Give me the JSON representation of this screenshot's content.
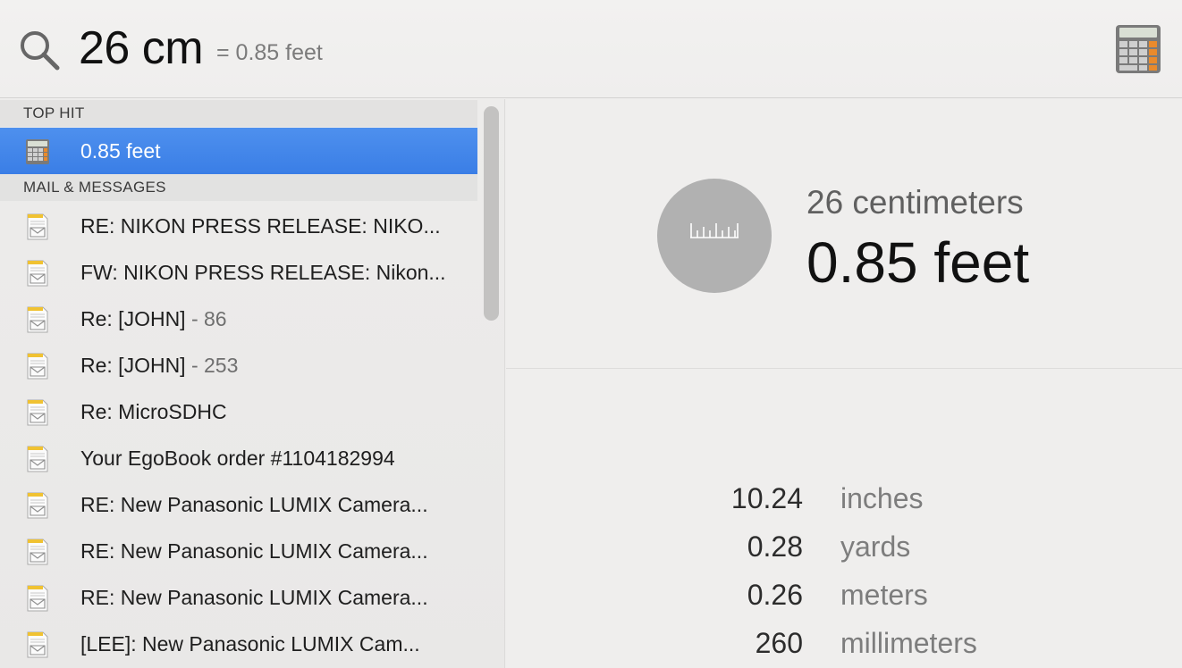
{
  "search": {
    "query": "26 cm",
    "inline_result": "= 0.85 feet",
    "search_icon": "magnifier-icon",
    "app_icon": "calculator-icon"
  },
  "sections": [
    {
      "title": "TOP HIT"
    },
    {
      "title": "MAIL & MESSAGES"
    }
  ],
  "top_hit": {
    "label": "0.85 feet",
    "icon": "calculator-icon",
    "selected": true
  },
  "mail_items": [
    {
      "label": "RE: NIKON PRESS RELEASE: NIKO...",
      "suffix": ""
    },
    {
      "label": "FW: NIKON PRESS RELEASE: Nikon...",
      "suffix": ""
    },
    {
      "label": "Re: [JOHN]",
      "suffix": "  - 86"
    },
    {
      "label": "Re: [JOHN]",
      "suffix": "  - 253"
    },
    {
      "label": "Re: MicroSDHC",
      "suffix": ""
    },
    {
      "label": "Your EgoBook order #1104182994",
      "suffix": ""
    },
    {
      "label": "RE: New Panasonic LUMIX Camera...",
      "suffix": ""
    },
    {
      "label": "RE: New Panasonic LUMIX Camera...",
      "suffix": ""
    },
    {
      "label": "RE: New Panasonic LUMIX Camera...",
      "suffix": ""
    },
    {
      "label": "[LEE]: New Panasonic LUMIX Cam...",
      "suffix": ""
    }
  ],
  "preview": {
    "icon": "ruler-icon",
    "from": "26 centimeters",
    "to": "0.85 feet",
    "conversions": [
      {
        "value": "10.24",
        "unit": "inches"
      },
      {
        "value": "0.28",
        "unit": "yards"
      },
      {
        "value": "0.26",
        "unit": "meters"
      },
      {
        "value": "260",
        "unit": "millimeters"
      }
    ]
  },
  "colors": {
    "selection": "#3f84ea",
    "background": "#eeedec"
  }
}
